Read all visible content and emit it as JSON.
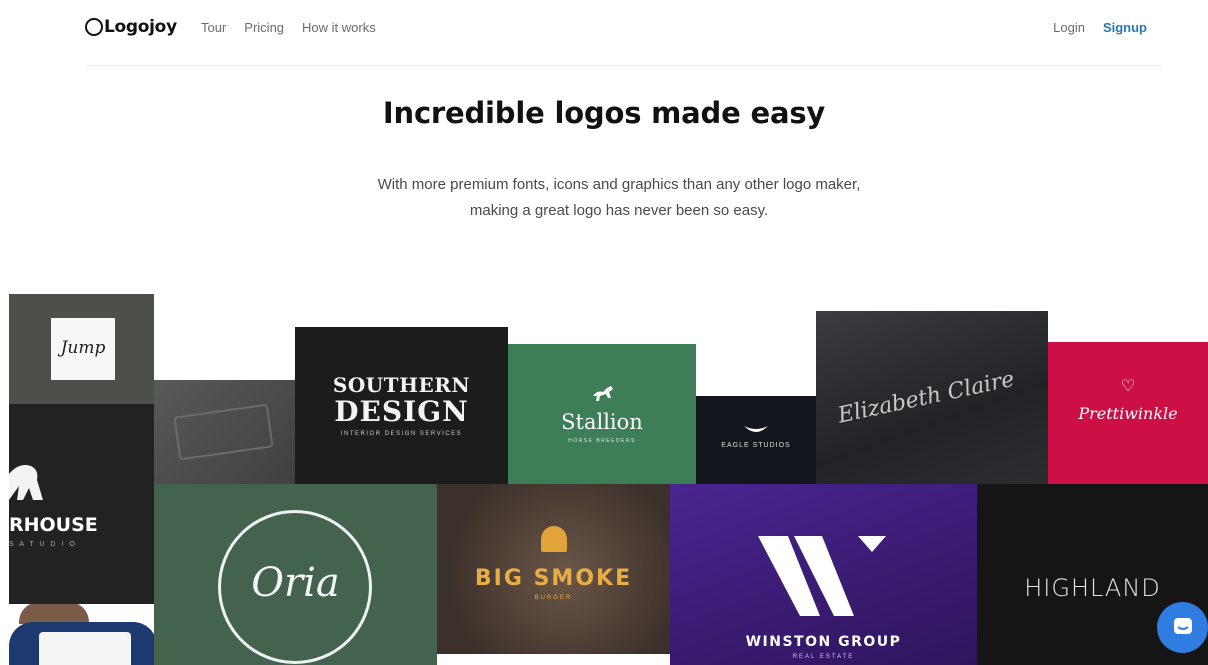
{
  "nav": {
    "logo": "Logojoy",
    "links": [
      "Tour",
      "Pricing",
      "How it works"
    ],
    "login": "Login",
    "signup": "Signup"
  },
  "hero": {
    "title": "Incredible logos made easy",
    "subtitle_line1": "With more premium fonts, icons and graphics than any other logo maker,",
    "subtitle_line2": "making a great logo has never been so easy."
  },
  "tiles": {
    "jump": "Jump",
    "warehouse": "RHOUSE",
    "warehouse_sub": "S A T U D I O",
    "southern_1": "SOUTHERN",
    "southern_2": "DESIGN",
    "southern_sub": "INTERIOR DESIGN SERVICES",
    "stallion": "Stallion",
    "stallion_sub": "HORSE BREEDERS",
    "eagle": "EAGLE STUDIOS",
    "elizabeth": "Elizabeth Claire",
    "pretty": "Prettiwinkle",
    "oria": "Oria",
    "bigsmoke": "BIG SMOKE",
    "bigsmoke_sub": "BURGER",
    "winston": "WINSTON GROUP",
    "winston_sub": "REAL ESTATE",
    "highland": "HIGHLAND"
  },
  "colors": {
    "signup": "#2b76b9",
    "chat_button": "#2f7de1"
  }
}
